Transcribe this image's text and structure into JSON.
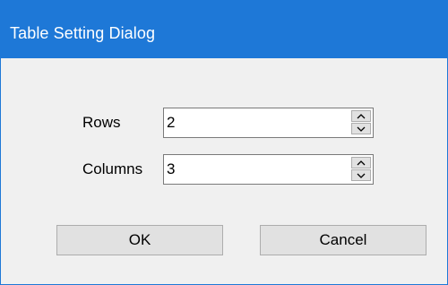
{
  "dialog": {
    "title": "Table Setting Dialog"
  },
  "fields": {
    "rows": {
      "label": "Rows",
      "value": "2"
    },
    "columns": {
      "label": "Columns",
      "value": "3"
    }
  },
  "buttons": {
    "ok_label": "OK",
    "cancel_label": "Cancel"
  },
  "icons": {
    "spin_up": "chevron-up-icon",
    "spin_down": "chevron-down-icon"
  },
  "colors": {
    "titlebar": "#1e78d7",
    "dialog_background": "#f0f0f0",
    "button_face": "#e1e1e1"
  }
}
